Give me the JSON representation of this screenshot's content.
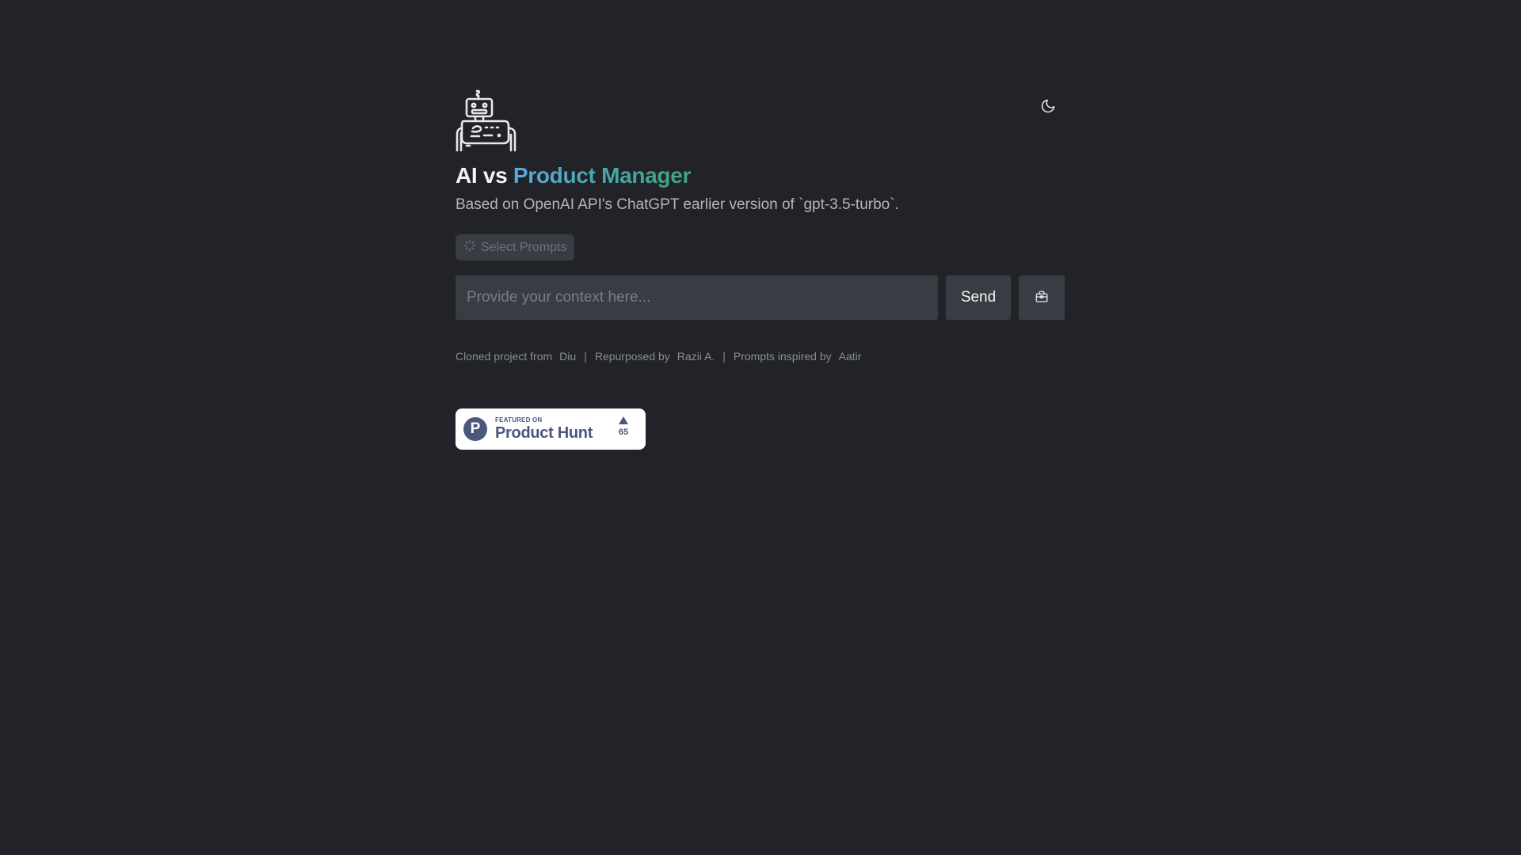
{
  "header": {
    "logo_icon": "robot-logo-icon",
    "theme_toggle_icon": "moon-icon"
  },
  "title": {
    "plain": "AI vs ",
    "highlight": "Product Manager"
  },
  "subtitle": "Based on OpenAI API's ChatGPT earlier version of `gpt-3.5-turbo`.",
  "prompts": {
    "select_label": "Select Prompts",
    "icon": "loading-spinner-icon"
  },
  "composer": {
    "placeholder": "Provide your context here...",
    "value": "",
    "send_label": "Send",
    "tool_icon": "briefcase-icon"
  },
  "credits": {
    "cloned_text": "Cloned project from",
    "cloned_link": "Diu",
    "sep1": "|",
    "repurposed_text": "Repurposed by",
    "repurposed_link": "Razii A.",
    "sep2": "|",
    "inspired_text": "Prompts inspired by",
    "inspired_link": "Aatir"
  },
  "product_hunt": {
    "letter": "P",
    "featured": "FEATURED ON",
    "name": "Product Hunt",
    "votes": "65",
    "color": "#4b587c"
  },
  "colors": {
    "background": "#212329",
    "surface": "#3a3c44",
    "gradient_start": "#5aa8e0",
    "gradient_end": "#3fa37c"
  }
}
